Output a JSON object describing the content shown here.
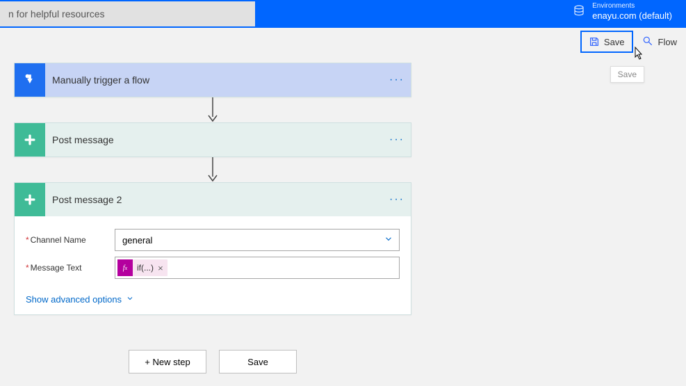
{
  "topbar": {
    "search_value": "n for helpful resources",
    "env_label": "Environments",
    "env_value": "enayu.com (default)"
  },
  "commands": {
    "save_label": "Save",
    "flow_label": "Flow",
    "tooltip": "Save"
  },
  "steps": {
    "trigger": {
      "title": "Manually trigger a flow"
    },
    "action1": {
      "title": "Post message"
    },
    "action2": {
      "title": "Post message 2",
      "channel_label": "Channel Name",
      "channel_value": "general",
      "message_label": "Message Text",
      "token_text": "if(...)",
      "advanced": "Show advanced options"
    }
  },
  "footer": {
    "new_step": "+ New step",
    "save": "Save"
  }
}
